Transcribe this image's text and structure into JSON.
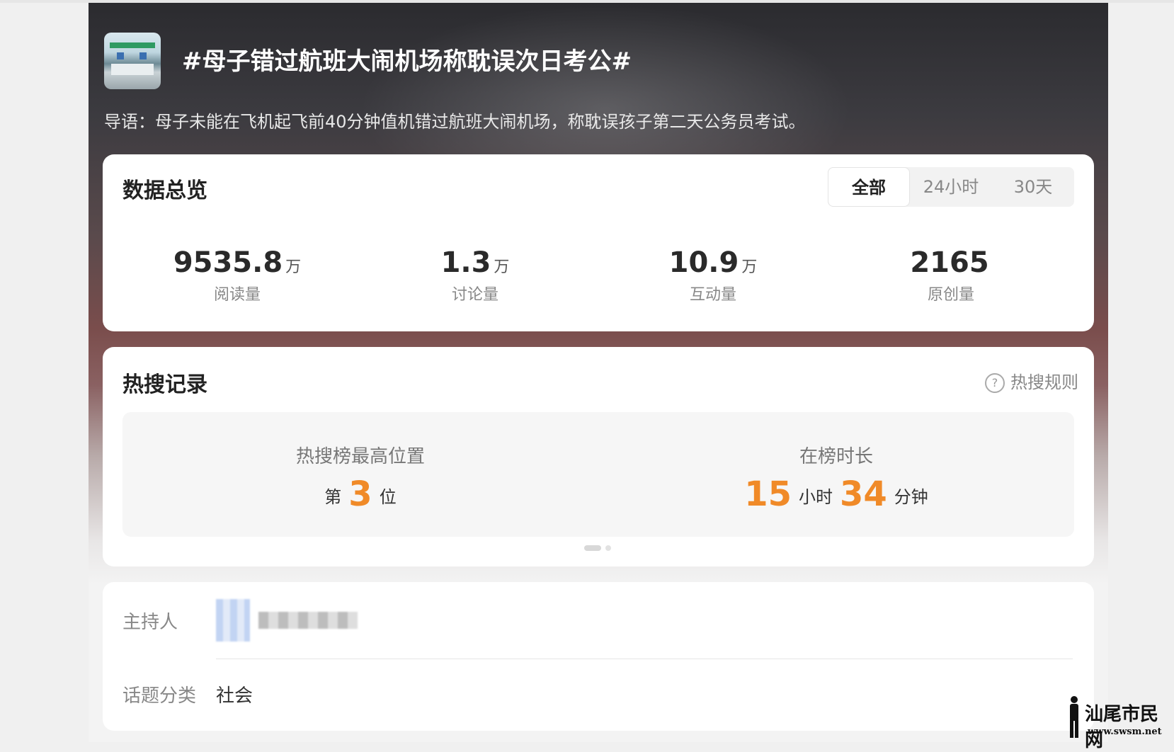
{
  "topic": {
    "title": "#母子错过航班大闹机场称耽误次日考公#",
    "intro": "导语：母子未能在飞机起飞前40分钟值机错过航班大闹机场，称耽误孩子第二天公务员考试。"
  },
  "overview": {
    "title": "数据总览",
    "tabs": [
      {
        "label": "全部",
        "active": true
      },
      {
        "label": "24小时",
        "active": false
      },
      {
        "label": "30天",
        "active": false
      }
    ],
    "stats": [
      {
        "value": "9535.8",
        "unit": "万",
        "label": "阅读量"
      },
      {
        "value": "1.3",
        "unit": "万",
        "label": "讨论量"
      },
      {
        "value": "10.9",
        "unit": "万",
        "label": "互动量"
      },
      {
        "value": "2165",
        "unit": "",
        "label": "原创量"
      }
    ]
  },
  "hot_search": {
    "title": "热搜记录",
    "rule_label": "热搜规则",
    "rule_icon": "question-circle-icon",
    "highest": {
      "label": "热搜榜最高位置",
      "prefix": "第",
      "value": "3",
      "suffix": "位"
    },
    "duration": {
      "label": "在榜时长",
      "hours": "15",
      "hours_unit": "小时",
      "minutes": "34",
      "minutes_unit": "分钟"
    },
    "accent_color": "#f08a28"
  },
  "info": {
    "host_label": "主持人",
    "category_label": "话题分类",
    "category_value": "社会"
  },
  "watermark": {
    "text": "汕尾市民网",
    "url": "www.swsm.net"
  }
}
